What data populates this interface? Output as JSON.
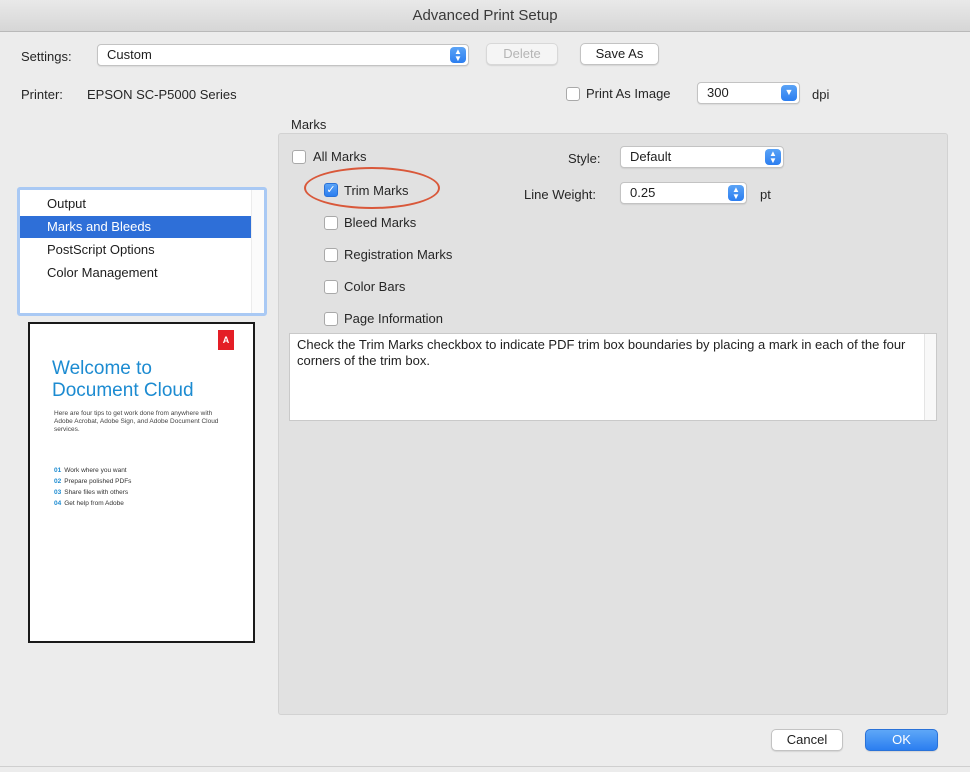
{
  "window": {
    "title": "Advanced Print Setup"
  },
  "settings": {
    "label": "Settings:",
    "value": "Custom",
    "delete_label": "Delete",
    "save_as_label": "Save As"
  },
  "printer": {
    "label": "Printer:",
    "value": "EPSON SC-P5000 Series",
    "print_as_image_label": "Print As Image",
    "dpi_value": "300",
    "dpi_unit": "dpi"
  },
  "sidebar": {
    "items": [
      {
        "label": "Output"
      },
      {
        "label": "Marks and Bleeds"
      },
      {
        "label": "PostScript Options"
      },
      {
        "label": "Color Management"
      }
    ]
  },
  "preview": {
    "logo": "A",
    "headline_line1": "Welcome to",
    "headline_line2": "Document Cloud",
    "body": "Here are four tips to get work done from anywhere with Adobe Acrobat, Adobe Sign, and Adobe Document Cloud services.",
    "tips": [
      {
        "num": "01",
        "text": "Work where you want"
      },
      {
        "num": "02",
        "text": "Prepare polished PDFs"
      },
      {
        "num": "03",
        "text": "Share files with others"
      },
      {
        "num": "04",
        "text": "Get help from Adobe"
      }
    ]
  },
  "marks": {
    "group_label": "Marks",
    "all_marks_label": "All Marks",
    "trim_marks_label": "Trim Marks",
    "bleed_marks_label": "Bleed Marks",
    "registration_marks_label": "Registration Marks",
    "color_bars_label": "Color Bars",
    "page_information_label": "Page Information",
    "style_label": "Style:",
    "style_value": "Default",
    "line_weight_label": "Line Weight:",
    "line_weight_value": "0.25",
    "line_weight_unit": "pt",
    "description": "Check the Trim Marks checkbox to indicate PDF trim box boundaries by placing a mark in each of the four corners of the trim box."
  },
  "footer": {
    "cancel_label": "Cancel",
    "ok_label": "OK"
  },
  "colors": {
    "accent": "#2c7ef0",
    "selection": "#2e6fd8",
    "highlight_ring": "#d9583a",
    "adobe_red": "#e41e26",
    "document_cloud_blue": "#1c8bd1"
  }
}
